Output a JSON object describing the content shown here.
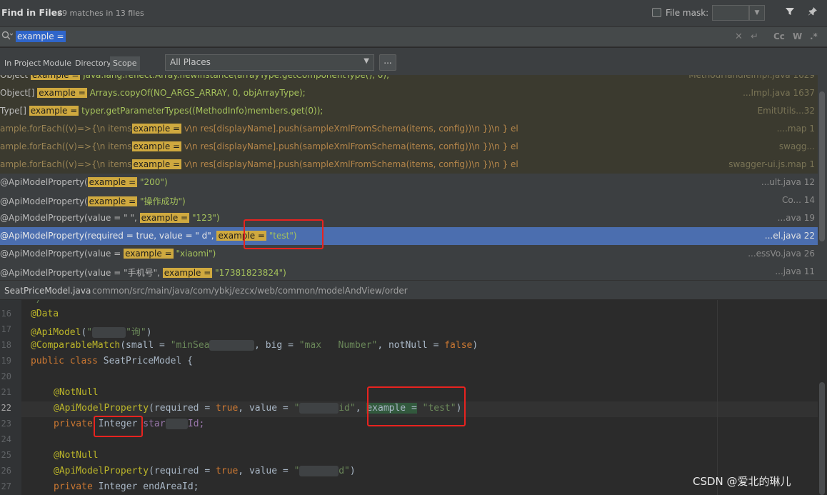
{
  "header": {
    "title": "Find in Files",
    "matches": "49 matches in 13 files",
    "file_mask_label": "File mask:",
    "file_mask_value": ""
  },
  "search": {
    "query": "example ="
  },
  "scopes": {
    "tabs": [
      "In Project",
      "Module",
      "Directory",
      "Scope"
    ],
    "active": "Scope",
    "places_value": "All Places",
    "browse_label": "..."
  },
  "results": [
    {
      "pre": "Object ",
      "match": "example =",
      "post": " java.lang.reflect.Array.newInstance(arrayType.getComponentType(), 0);",
      "file": "MethodHandleImpl.java 1629",
      "type": "lib"
    },
    {
      "pre": "Object[] ",
      "match": "example =",
      "post": " Arrays.copyOf(NO_ARGS_ARRAY, 0, objArrayType);",
      "file": "...Impl.java 1637",
      "type": "lib"
    },
    {
      "pre": "Type[] ",
      "match": "example =",
      "post": " typer.getParameterTypes((MethodInfo)members.get(0));",
      "file": "EmitUtils...32",
      "type": "lib"
    },
    {
      "pre": "ample.forEach((v)=>{\\n            items",
      "match": "example =",
      "post": " v\\n            res[displayName].push(sampleXmlFromSchema(items, config))\\n            })\\n          } el",
      "file": "....map 1",
      "type": "js"
    },
    {
      "pre": "ample.forEach((v)=>{\\n            items",
      "match": "example =",
      "post": " v\\n            res[displayName].push(sampleXmlFromSchema(items, config))\\n            })\\n          } el",
      "file": "swagg...",
      "type": "js"
    },
    {
      "pre": "ample.forEach((v)=>{\\n            items",
      "match": "example =",
      "post": " v\\n            res[displayName].push(sampleXmlFromSchema(items, config))\\n            })\\n          } el",
      "file": "swagger-ui.js.map 1",
      "type": "js"
    },
    {
      "pre": "@ApiModelProperty(",
      "match": "example =",
      "post": " \"200\")",
      "file": "...ult.java 12",
      "type": "src"
    },
    {
      "pre": "@ApiModelProperty(",
      "match": "example =",
      "post": " \"操作成功\")",
      "file": "Co... 14",
      "type": "src"
    },
    {
      "pre": "@ApiModelProperty(value = \"      \", ",
      "match": "example =",
      "post": " \"123\")",
      "file": "...ava 19",
      "type": "src"
    },
    {
      "pre": "@ApiModelProperty(required = true, value = \"          d\", ",
      "match": "example =",
      "post": " \"test\")",
      "file": "...el.java 22",
      "type": "sel"
    },
    {
      "pre": "@ApiModelProperty(value =            ",
      "match": "example =",
      "post": " \"xiaomi\")",
      "file": "...essVo.java 26",
      "type": "src"
    },
    {
      "pre": "@ApiModelProperty(value = \"手机号\", ",
      "match": "example =",
      "post": " \"17381823824\")",
      "file": "...java 11",
      "type": "src"
    }
  ],
  "pathbar": {
    "file": "SeatPriceModel.java",
    "path": "common/src/main/java/com/ybkj/ezcx/web/common/modelAndView/order"
  },
  "editor": {
    "line_numbers": [
      "16",
      "17",
      "18",
      "19",
      "20",
      "21",
      "22",
      "23",
      "24",
      "25",
      "26",
      "27"
    ],
    "current_line": "22",
    "l16_ann": "@Data",
    "l17_ann": "@ApiModel",
    "l17_str": "\"询\"",
    "l18_ann": "@ComparableMatch",
    "l18_text1": "(small = ",
    "l18_str1": "\"minSea",
    "l18_text2": ", big = ",
    "l18_str2": "\"max   Number\"",
    "l18_text3": ", notNull = ",
    "l18_kw": "false",
    "l18_text4": ")",
    "l19_kw": "public class",
    "l19_text": " SeatPriceModel {",
    "l21_ann": "@NotNull",
    "l22_ann": "@ApiModelProperty",
    "l22_text1": "(required = ",
    "l22_kw": "true",
    "l22_text2": ", value = ",
    "l22_str1": "\"",
    "l22_str1b": "id\"",
    "l22_text3": ", ",
    "l22_match": "example =",
    "l22_str2": " \"test\"",
    "l22_text4": ")",
    "l23_kw": "private",
    "l23_type": "Integer",
    "l23_field": "star",
    "l23_field_b": "Id;",
    "l25_ann": "@NotNull",
    "l26_ann": "@ApiModelProperty",
    "l26_text1": "(required = ",
    "l26_kw": "true",
    "l26_text2": ", value = ",
    "l26_str": "\"",
    "l26_str_b": "d\"",
    "l26_text3": ")",
    "l27_kw": "private",
    "l27_text": " Integer endAreaId;"
  },
  "watermark": "CSDN @爱北的琳儿",
  "icons": [
    "filter-icon",
    "pin-icon",
    "search-icon",
    "clear-icon",
    "newline-icon",
    "match-case-icon",
    "words-icon",
    "regex-icon"
  ]
}
